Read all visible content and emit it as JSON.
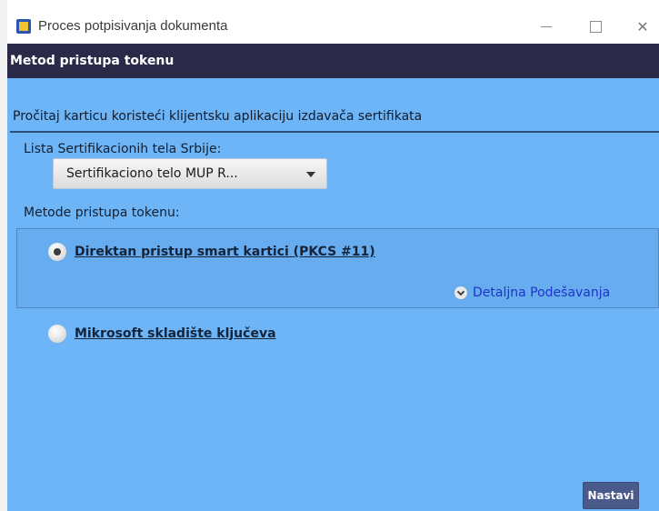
{
  "window": {
    "title": "Proces potpisivanja dokumenta",
    "controls": {
      "minimize_icon": "minimize-icon",
      "maximize_icon": "maximize-icon",
      "close_icon": "close-icon"
    }
  },
  "header": {
    "title": "Metod pristupa tokenu"
  },
  "content": {
    "intro_text": "Pročitaj karticu koristeći klijentsku aplikaciju izdavača sertifikata",
    "list_label": "Lista Sertifikacionih tela Srbije:",
    "dropdown": {
      "selected": "Sertifikaciono telo MUP R..."
    },
    "methods_label": "Metode pristupa tokenu:",
    "options": [
      {
        "label": "Direktan pristup smart kartici (PKCS #11)",
        "selected": true
      },
      {
        "label": "Mikrosoft skladište ključeva",
        "selected": false
      }
    ],
    "advanced_link": "Detaljna Podešavanja",
    "next_button": "Nastavi"
  },
  "colors": {
    "header_bg": "#2a2a48",
    "content_bg": "#6eb5f7",
    "button_bg": "#4a5a8a",
    "link": "#1c34c8"
  }
}
